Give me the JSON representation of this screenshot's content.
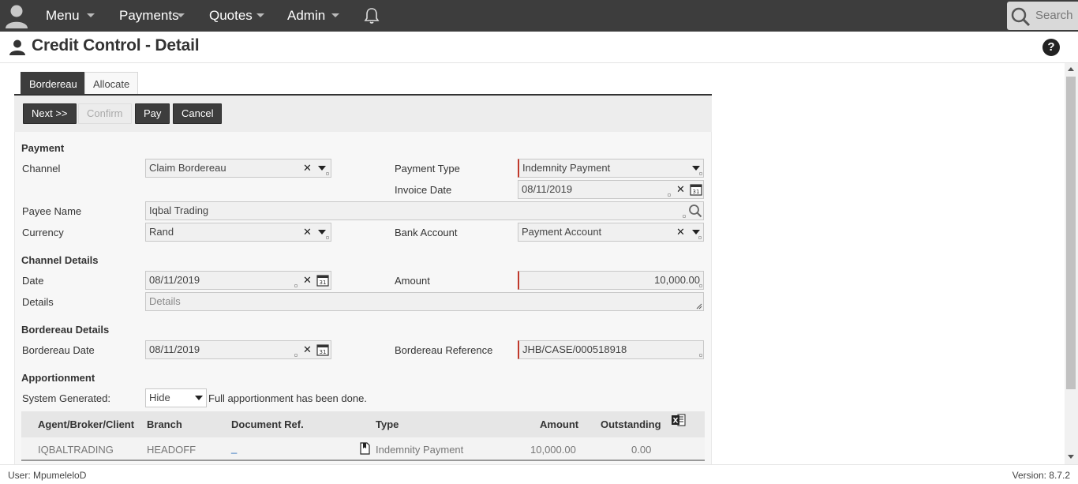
{
  "nav": {
    "menu": "Menu",
    "payments": "Payments",
    "quotes": "Quotes",
    "admin": "Admin",
    "search_placeholder": "Search"
  },
  "page": {
    "title": "Credit Control - Detail",
    "help": "?"
  },
  "tabs": [
    "Bordereau",
    "Allocate"
  ],
  "buttons": {
    "next": "Next >>",
    "confirm": "Confirm",
    "pay": "Pay",
    "cancel": "Cancel"
  },
  "sections": {
    "payment": "Payment",
    "channel_details": "Channel Details",
    "bordereau_details": "Bordereau Details",
    "apportionment": "Apportionment"
  },
  "labels": {
    "channel": "Channel",
    "payment_type": "Payment Type",
    "invoice_date": "Invoice Date",
    "payee_name": "Payee Name",
    "currency": "Currency",
    "bank_account": "Bank Account",
    "date": "Date",
    "amount": "Amount",
    "details": "Details",
    "bordereau_date": "Bordereau Date",
    "bordereau_reference": "Bordereau Reference",
    "system_generated": "System Generated:",
    "apportionment_note": "Full apportionment has been done."
  },
  "values": {
    "channel": "Claim Bordereau",
    "payment_type": "Indemnity Payment",
    "invoice_date": "08/11/2019",
    "payee_name": "Iqbal Trading",
    "currency": "Rand",
    "bank_account": "Payment Account",
    "date": "08/11/2019",
    "amount": "10,000.00",
    "details_placeholder": "Details",
    "bordereau_date": "08/11/2019",
    "bordereau_reference": "JHB/CASE/000518918",
    "system_generated": "Hide"
  },
  "table": {
    "headers": [
      "Agent/Broker/Client",
      "Branch",
      "Document Ref.",
      "Type",
      "Amount",
      "Outstanding"
    ],
    "rows": [
      {
        "agent": "IQBALTRADING",
        "branch": "HEADOFF",
        "doc_ref": "_",
        "type": "Indemnity Payment",
        "amount": "10,000.00",
        "outstanding": "0.00"
      }
    ]
  },
  "footer": {
    "user": "User: MpumeleloD",
    "version": "Version: 8.7.2"
  },
  "calendar_day": "31",
  "excel_mark": "X"
}
